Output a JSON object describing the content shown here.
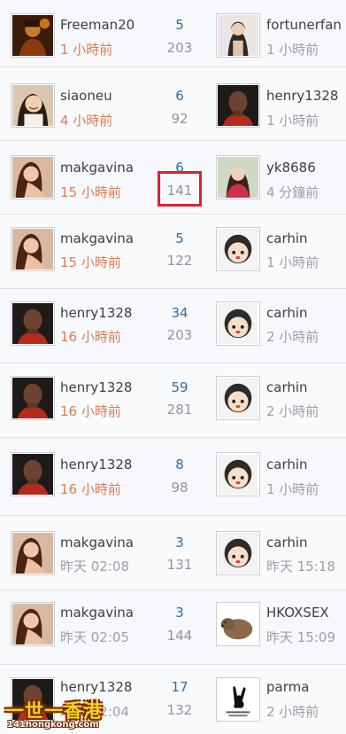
{
  "colors": {
    "recent_time": "#e07b53",
    "old_time": "#9aa0a6",
    "replies": "#2f6ea5",
    "views": "#8e959c",
    "highlight": "#d9232d"
  },
  "rows": [
    {
      "author": "Freeman20",
      "author_avatar": "fireman-avatar",
      "author_time": "1 小時前",
      "replies": "5",
      "views": "203",
      "last_user": "fortunerfan",
      "last_avatar": "woman-avatar",
      "last_time": "1 小時前"
    },
    {
      "author": "siaoneu",
      "author_avatar": "woman-smile-avatar",
      "author_time": "4 小時前",
      "replies": "6",
      "views": "92",
      "last_user": "henry1328",
      "last_avatar": "man-avatar",
      "last_time": "1 小時前"
    },
    {
      "author": "makgavina",
      "author_avatar": "woman-pose-avatar",
      "author_time": "15 小時前",
      "replies": "6",
      "views": "141",
      "last_user": "yk8686",
      "last_avatar": "woman-red-avatar",
      "last_time": "4 分鐘前"
    },
    {
      "author": "makgavina",
      "author_avatar": "woman-pose-avatar",
      "author_time": "15 小時前",
      "replies": "5",
      "views": "122",
      "last_user": "carhin",
      "last_avatar": "cartoon-avatar",
      "last_time": "1 小時前"
    },
    {
      "author": "henry1328",
      "author_avatar": "man-avatar",
      "author_time": "16 小時前",
      "replies": "34",
      "views": "203",
      "last_user": "carhin",
      "last_avatar": "cartoon-avatar",
      "last_time": "2 小時前"
    },
    {
      "author": "henry1328",
      "author_avatar": "man-avatar",
      "author_time": "16 小時前",
      "replies": "59",
      "views": "281",
      "last_user": "carhin",
      "last_avatar": "cartoon-avatar",
      "last_time": "2 小時前"
    },
    {
      "author": "henry1328",
      "author_avatar": "man-avatar",
      "author_time": "16 小時前",
      "replies": "8",
      "views": "98",
      "last_user": "carhin",
      "last_avatar": "cartoon-avatar",
      "last_time": "1 小時前"
    },
    {
      "author": "makgavina",
      "author_avatar": "woman-pose-avatar",
      "author_time": "昨天 02:08",
      "replies": "3",
      "views": "131",
      "last_user": "carhin",
      "last_avatar": "cartoon-avatar",
      "last_time": "昨天 15:18"
    },
    {
      "author": "makgavina",
      "author_avatar": "woman-pose-avatar",
      "author_time": "昨天 02:05",
      "replies": "3",
      "views": "144",
      "last_user": "HKOXSEX",
      "last_avatar": "wombat-avatar",
      "last_time": "昨天 15:09"
    },
    {
      "author": "henry1328",
      "author_avatar": "man-avatar",
      "author_time": "昨天 02:04",
      "replies": "17",
      "views": "132",
      "last_user": "parma",
      "last_avatar": "bunny-logo-avatar",
      "last_time": "2 小時前"
    }
  ],
  "highlighted_row": 2,
  "watermark": {
    "main": "一世一香港",
    "sub": "141hongkong.com"
  }
}
